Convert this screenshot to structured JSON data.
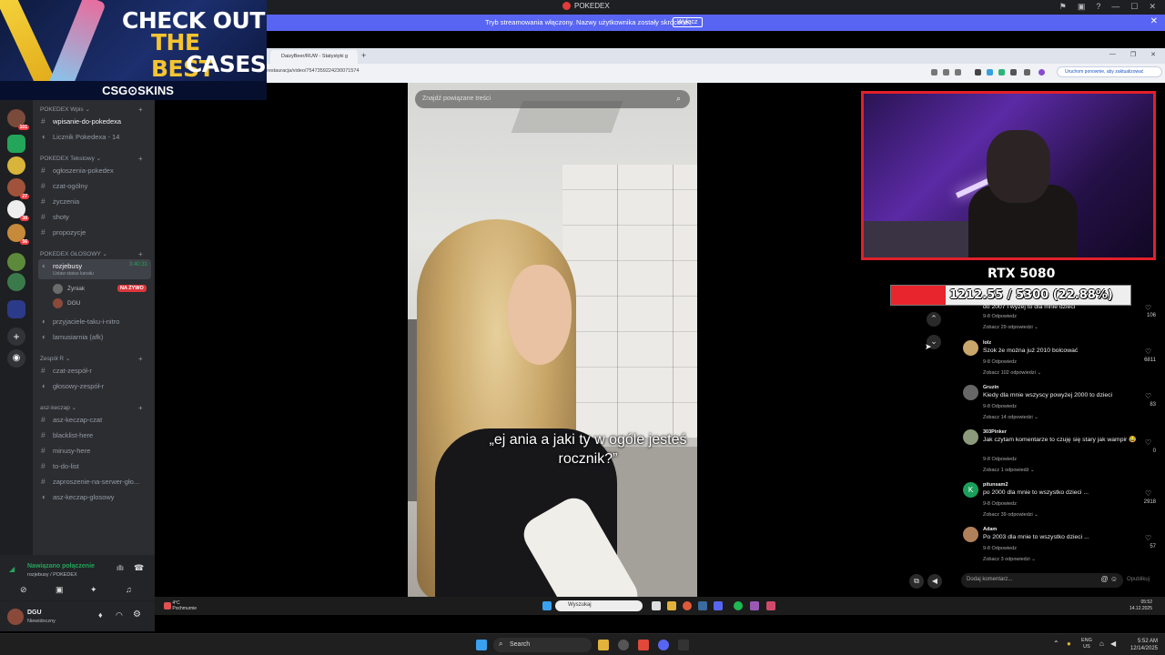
{
  "window": {
    "title": "POKEDEX"
  },
  "streaming_bar": {
    "message": "Tryb streamowania włączony. Nazwy użytkownika zostały skrócone.",
    "button": "Wyłącz"
  },
  "ad": {
    "line1": "CHECK OUT",
    "line2": "THE BEST",
    "line3": "CASES",
    "brand": "CSG⊙SKINS"
  },
  "servers": [
    {
      "badge": "101"
    },
    {
      "badge": ""
    },
    {
      "badge": ""
    },
    {
      "badge": "27"
    },
    {
      "badge": "38"
    },
    {
      "badge": "56"
    },
    {
      "badge": ""
    },
    {
      "badge": ""
    },
    {
      "badge": ""
    }
  ],
  "channels": {
    "cat_wpis": "POKEDEX Wpis",
    "wpisanie": "wpisanie-do-pokedexa",
    "licznik": "Licznik Pokedexa - 14",
    "cat_tekstowy": "POKEDEX Tekstowy",
    "ogloszenia": "ogłoszenia-pokedex",
    "czat": "czat-ogólny",
    "zyczenia": "życzenia",
    "shoty": "shoty",
    "propozycje": "propozycje",
    "cat_glosowy": "POKEDEX GŁOSOWY",
    "rozjebusy": "rozjebusy",
    "rozjebusy_time": "3:40:31",
    "status": "Ustaw status kanału",
    "user1": "Żyniak",
    "live": "NA ŻYWO",
    "user2": "DGU",
    "przyjaciele": "przyjaciele-taku-i-nitro",
    "lamusiarnia": "lamusiarnia (afk)",
    "cat_zespol": "Zespół R",
    "czat_zespol": "czat-zespół-r",
    "glosowy_zespol": "głosowy-zespół-r",
    "cat_asz": "asz-keczap",
    "asz_czat": "asz-keczap-czat",
    "blacklist": "blacklist-here",
    "minusy": "minusy-here",
    "todo": "to-do-list",
    "zaproszenie": "zaproszenie-na-serwer-gło...",
    "asz_glosowy": "asz-keczap-glosowy"
  },
  "voice_panel": {
    "status": "Nawiązano połączenie",
    "location": "rozjebusy / POKEDEX"
  },
  "user_panel": {
    "name": "DGU",
    "status": "Niewidoczny"
  },
  "browser": {
    "tab": "DaizyBeer/RUW - Statystyki g",
    "url": "restauracja/video/7547359224230071574",
    "relaunch": "Uruchom ponownie, aby zaktualizować"
  },
  "video": {
    "search_placeholder": "Znajdź powiązane treści",
    "caption": "„ej ania a jaki ty w ogóle jesteś rocznik?”"
  },
  "overlay": {
    "title": "RTX 5080",
    "progress_text": "1212.55 / 5300 (22.88%)",
    "progress_fraction": 0.2288
  },
  "comments": [
    {
      "user": "",
      "text": "do 2007 i wyżej to dla mnie dzieci",
      "meta": "9-8   Odpowiedz",
      "more": "Zobacz 29 odpowiedzi ⌄",
      "likes": "106",
      "color": "#888888"
    },
    {
      "user": "lolz",
      "text": "Szok że można już 2010 bolcować",
      "meta": "9-8   Odpowiedz",
      "more": "Zobacz 102 odpowiedzi ⌄",
      "likes": "6811",
      "color": "#c9a66b"
    },
    {
      "user": "Gruzin",
      "text": "Kiedy dla mnie wszyscy powyżej 2000 to dzieci",
      "meta": "9-8   Odpowiedz",
      "more": "Zobacz 14 odpowiedzi ⌄",
      "likes": "83",
      "color": "#666666"
    },
    {
      "user": "303Pinker",
      "text": "Jak czytam komentarze to czuję się stary jak wampir 😂",
      "meta": "9-8   Odpowiedz",
      "more": "Zobacz 1 odpowiedź ⌄",
      "likes": "0",
      "color": "#8a9a7a"
    },
    {
      "user": "pitunsam2",
      "text": "po 2000 dla mnie to wszystko dzieci ...",
      "meta": "9-8   Odpowiedz",
      "more": "Zobacz 39 odpowiedzi ⌄",
      "likes": "2918",
      "color": "#1aa05a"
    },
    {
      "user": "Adam",
      "text": "Po 2003 dla mnie to wszystko dzieci ...",
      "meta": "9-8   Odpowiedz",
      "more": "Zobacz 3 odpowiedzi ⌄",
      "likes": "57",
      "color": "#b0805a"
    }
  ],
  "comment_input": {
    "placeholder": "Dodaj komentarz...",
    "post": "Opublikuj"
  },
  "inner_taskbar": {
    "temp": "4°C",
    "weather": "Pochmurnie",
    "search": "Wyszukaj",
    "time": "05:52",
    "date": "14.12.2025"
  },
  "taskbar": {
    "search": "Search",
    "lang1": "ENG",
    "lang2": "US",
    "time": "5:52 AM",
    "date": "12/14/2025"
  }
}
